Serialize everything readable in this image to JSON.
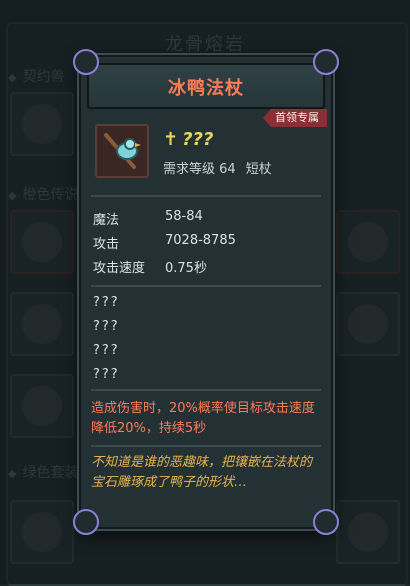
{
  "background": {
    "title": "龙骨熔岩",
    "sections": [
      "契约兽",
      "橙色传说",
      "绿色套装"
    ]
  },
  "tooltip": {
    "title": "冰鸭法杖",
    "badge": "首领专属",
    "item_icon": "duck-staff-icon",
    "name_symbol": "✝",
    "name": "???",
    "requirement": "需求等级 64",
    "weapon_type": "短杖",
    "stats": [
      {
        "label": "魔法",
        "value": "58-84"
      },
      {
        "label": "攻击",
        "value": "7028-8785"
      },
      {
        "label": "攻击速度",
        "value": "0.75秒"
      }
    ],
    "unknown_lines": [
      "???",
      "???",
      "???",
      "???"
    ],
    "effect": "造成伤害时，20%概率使目标攻击速度降低20%，持续5秒",
    "flavor": "不知道是谁的恶趣味，把镶嵌在法杖的宝石雕琢成了鸭子的形状…",
    "colors": {
      "title": "#ff7e57",
      "name": "#e8d55a",
      "effect": "#ff7a57",
      "flavor": "#e7b34a",
      "badge": "#8b2f35"
    }
  }
}
